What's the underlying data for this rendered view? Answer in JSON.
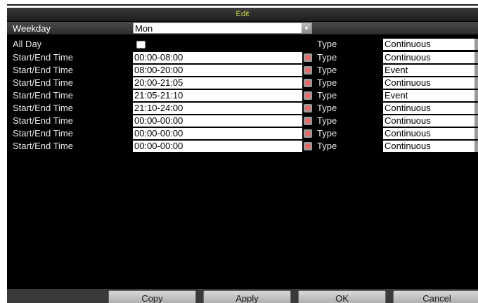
{
  "title": "Edit",
  "weekday": {
    "label": "Weekday",
    "value": "Mon"
  },
  "all_day": {
    "label": "All Day",
    "checked": false,
    "type_label": "Type",
    "type_value": "Continuous"
  },
  "rows": [
    {
      "label": "Start/End Time",
      "time": "00:00-08:00",
      "type_label": "Type",
      "type": "Continuous"
    },
    {
      "label": "Start/End Time",
      "time": "08:00-20:00",
      "type_label": "Type",
      "type": "Event"
    },
    {
      "label": "Start/End Time",
      "time": "20:00-21:05",
      "type_label": "Type",
      "type": "Continuous"
    },
    {
      "label": "Start/End Time",
      "time": "21:05-21:10",
      "type_label": "Type",
      "type": "Event"
    },
    {
      "label": "Start/End Time",
      "time": "21:10-24:00",
      "type_label": "Type",
      "type": "Continuous"
    },
    {
      "label": "Start/End Time",
      "time": "00:00-00:00",
      "type_label": "Type",
      "type": "Continuous"
    },
    {
      "label": "Start/End Time",
      "time": "00:00-00:00",
      "type_label": "Type",
      "type": "Continuous"
    },
    {
      "label": "Start/End Time",
      "time": "00:00-00:00",
      "type_label": "Type",
      "type": "Continuous"
    }
  ],
  "buttons": {
    "copy": "Copy",
    "apply": "Apply",
    "ok": "OK",
    "cancel": "Cancel"
  },
  "colors": {
    "title_text": "#c7d34a",
    "background": "#000000",
    "input": "#ffffff"
  }
}
